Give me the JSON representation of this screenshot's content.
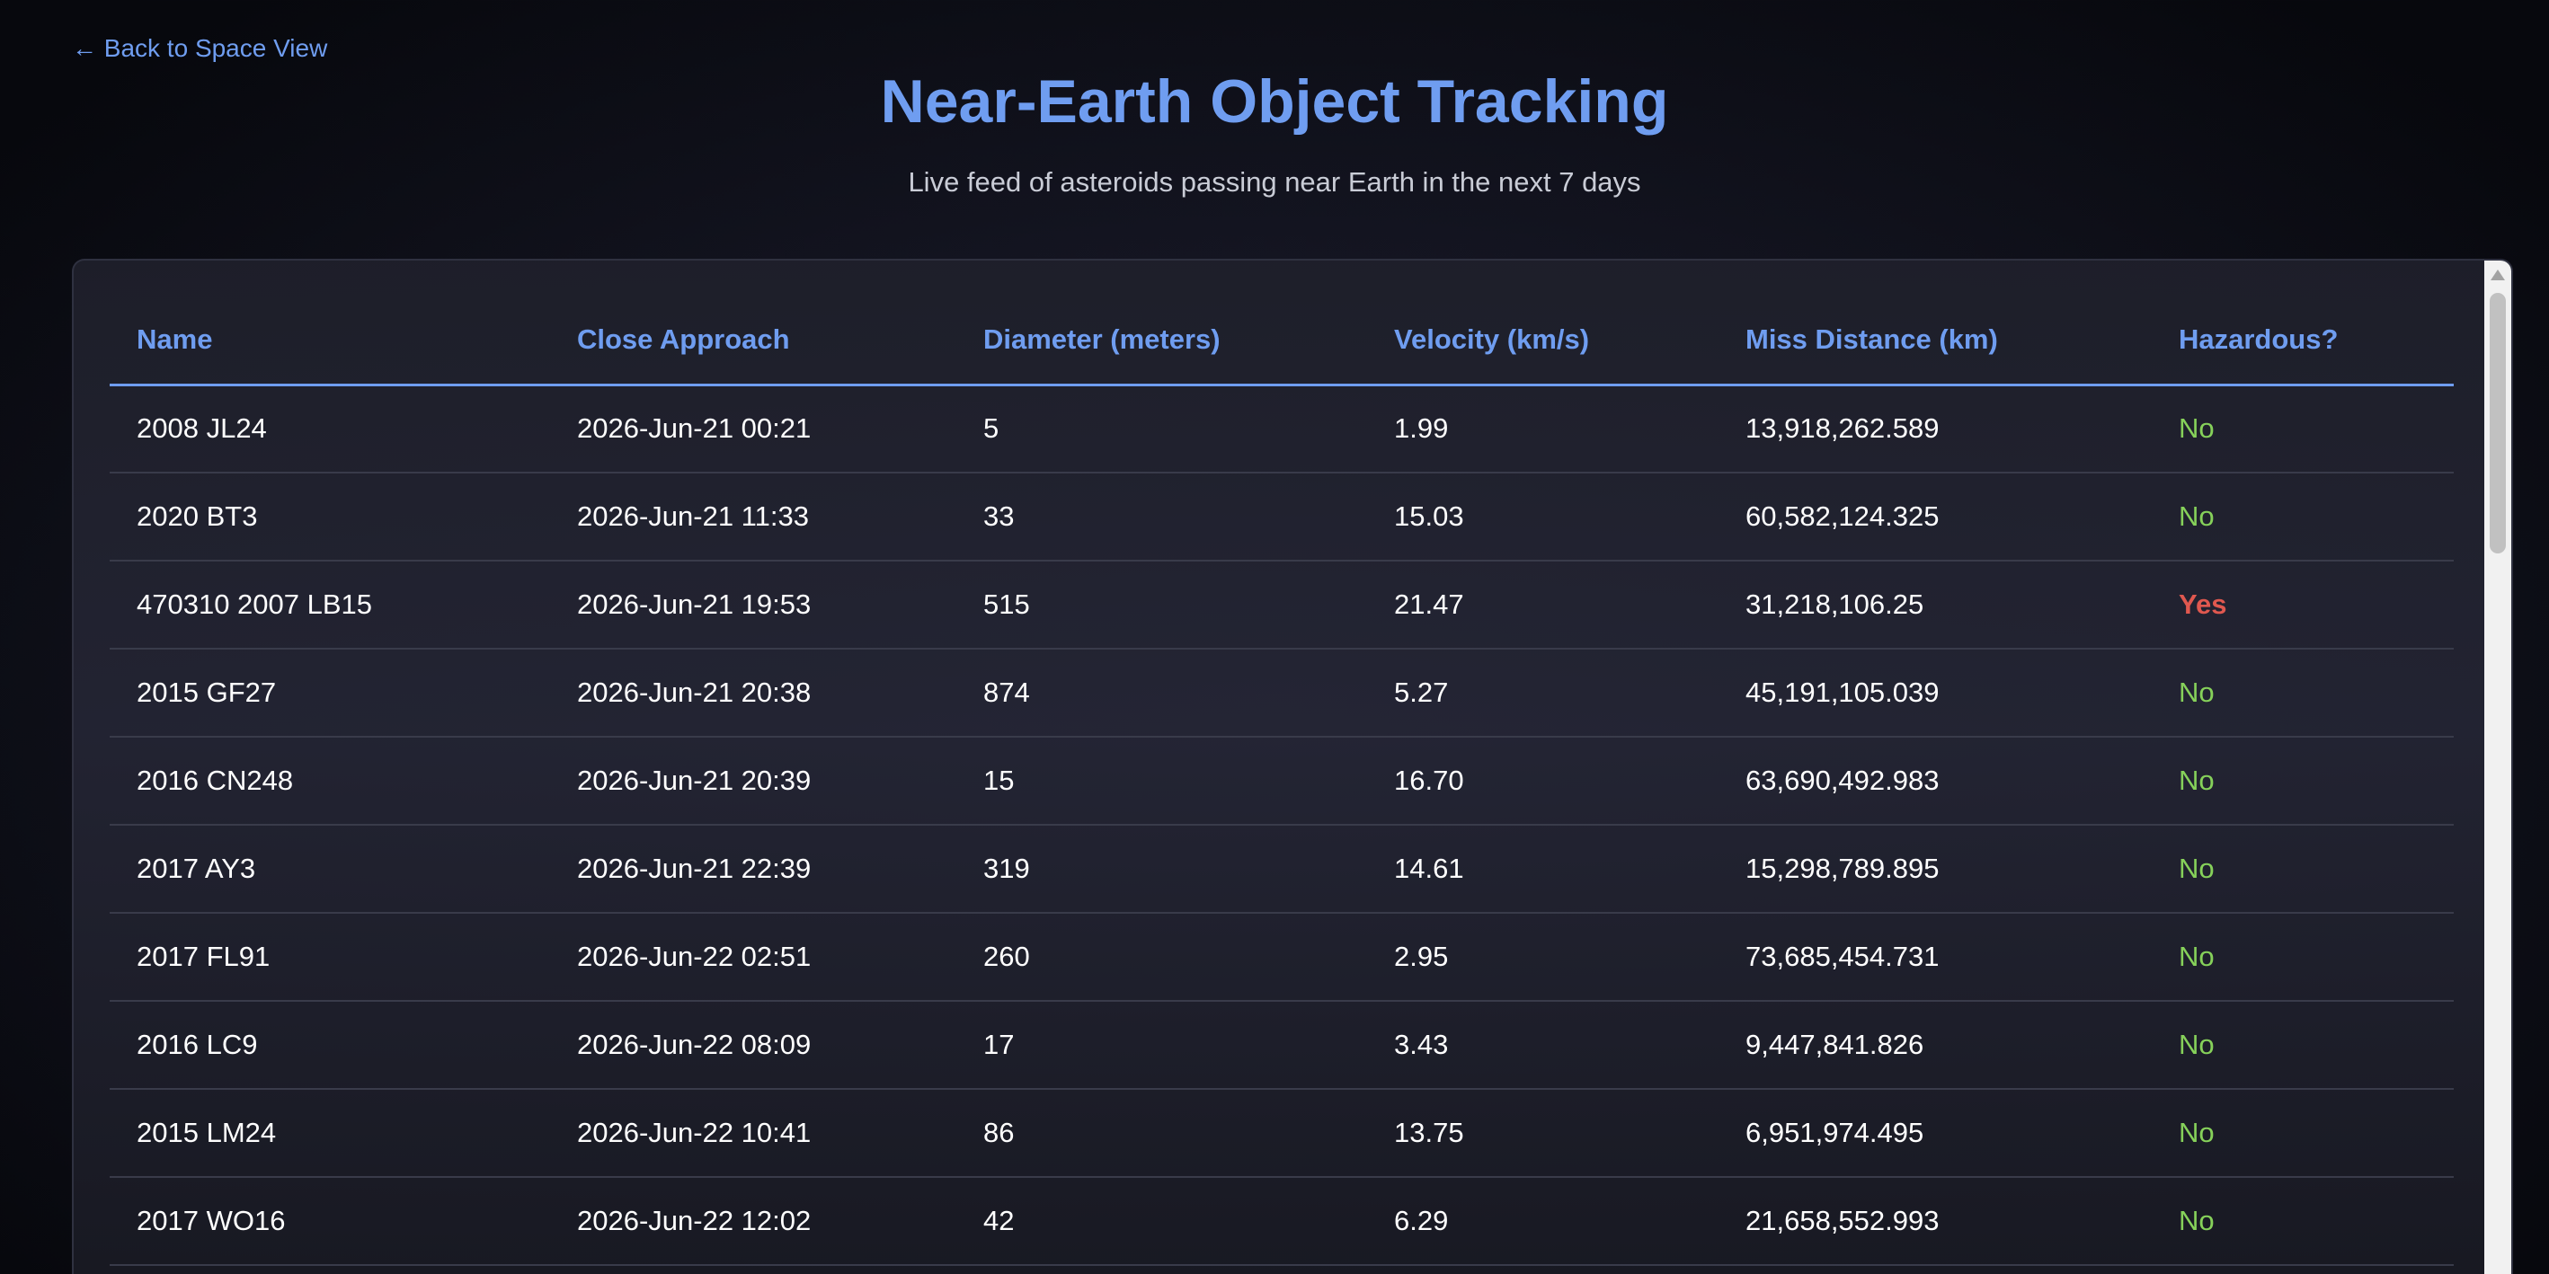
{
  "nav": {
    "back_label": "← Back to Space View"
  },
  "header": {
    "title": "Near-Earth Object Tracking",
    "subtitle": "Live feed of asteroids passing near Earth in the next 7 days"
  },
  "colors": {
    "accent": "#6f9df0",
    "hazard_no": "#86d15a",
    "hazard_yes": "#e0584f",
    "background": "#151623"
  },
  "table": {
    "columns": [
      "Name",
      "Close Approach",
      "Diameter (meters)",
      "Velocity (km/s)",
      "Miss Distance (km)",
      "Hazardous?"
    ],
    "rows": [
      [
        "2008 JL24",
        "2026-Jun-21 00:21",
        "5",
        "1.99",
        "13,918,262.589",
        "No"
      ],
      [
        "2020 BT3",
        "2026-Jun-21 11:33",
        "33",
        "15.03",
        "60,582,124.325",
        "No"
      ],
      [
        "470310 2007 LB15",
        "2026-Jun-21 19:53",
        "515",
        "21.47",
        "31,218,106.25",
        "Yes"
      ],
      [
        "2015 GF27",
        "2026-Jun-21 20:38",
        "874",
        "5.27",
        "45,191,105.039",
        "No"
      ],
      [
        "2016 CN248",
        "2026-Jun-21 20:39",
        "15",
        "16.70",
        "63,690,492.983",
        "No"
      ],
      [
        "2017 AY3",
        "2026-Jun-21 22:39",
        "319",
        "14.61",
        "15,298,789.895",
        "No"
      ],
      [
        "2017 FL91",
        "2026-Jun-22 02:51",
        "260",
        "2.95",
        "73,685,454.731",
        "No"
      ],
      [
        "2016 LC9",
        "2026-Jun-22 08:09",
        "17",
        "3.43",
        "9,447,841.826",
        "No"
      ],
      [
        "2015 LM24",
        "2026-Jun-22 10:41",
        "86",
        "13.75",
        "6,951,974.495",
        "No"
      ],
      [
        "2017 WO16",
        "2026-Jun-22 12:02",
        "42",
        "6.29",
        "21,658,552.993",
        "No"
      ]
    ]
  }
}
